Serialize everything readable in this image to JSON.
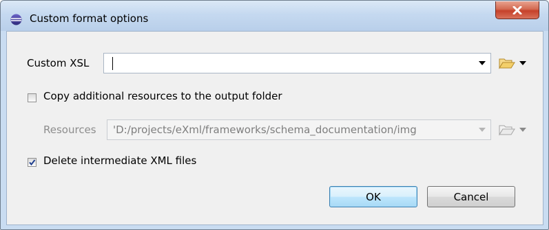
{
  "window": {
    "title": "Custom format options"
  },
  "custom_xsl": {
    "label": "Custom XSL",
    "value": ""
  },
  "copy_resources": {
    "label": "Copy additional resources to the output folder",
    "checked": false
  },
  "resources": {
    "label": "Resources",
    "value": "'D:/projects/eXml/frameworks/schema_documentation/img"
  },
  "delete_intermediate": {
    "label": "Delete intermediate XML files",
    "checked": true
  },
  "buttons": {
    "ok": "OK",
    "cancel": "Cancel"
  },
  "colors": {
    "accent": "#3c7fb1",
    "close": "#c6412a",
    "folder": "#e8b94a"
  },
  "icons": [
    "app-icon",
    "close-icon",
    "folder-icon",
    "dropdown-arrow-icon",
    "checkmark-icon"
  ]
}
